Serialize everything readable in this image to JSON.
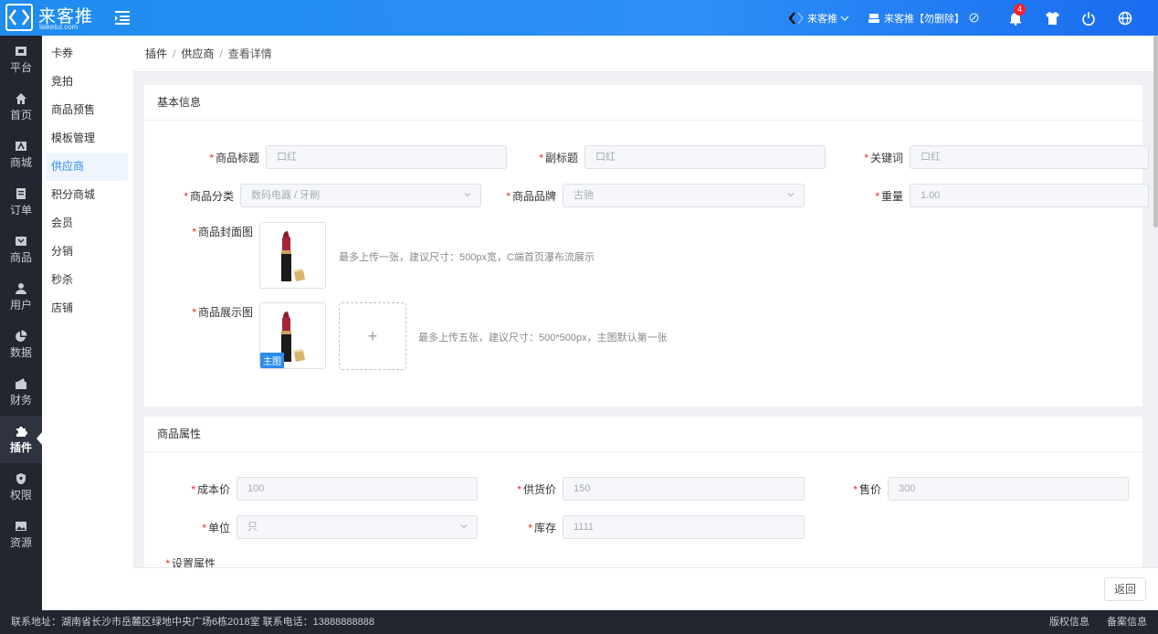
{
  "app": {
    "logo_name": "来客推",
    "logo_sub": "laiketui.com"
  },
  "topbar": {
    "store_label": "来客推",
    "user_label": "来客推【勿删除】",
    "notification_count": "4"
  },
  "leftnav": [
    {
      "label": "平台",
      "icon": "platform-icon"
    },
    {
      "label": "首页",
      "icon": "home-icon"
    },
    {
      "label": "商城",
      "icon": "mall-icon"
    },
    {
      "label": "订单",
      "icon": "order-icon"
    },
    {
      "label": "商品",
      "icon": "product-icon"
    },
    {
      "label": "用户",
      "icon": "user-icon"
    },
    {
      "label": "数据",
      "icon": "pie-chart-icon"
    },
    {
      "label": "财务",
      "icon": "wallet-icon"
    },
    {
      "label": "插件",
      "icon": "puzzle-icon",
      "active": true
    },
    {
      "label": "权限",
      "icon": "shield-icon"
    },
    {
      "label": "资源",
      "icon": "image-icon"
    }
  ],
  "subnav": [
    {
      "label": "卡券"
    },
    {
      "label": "竞拍"
    },
    {
      "label": "商品预售"
    },
    {
      "label": "模板管理"
    },
    {
      "label": "供应商",
      "active": true
    },
    {
      "label": "积分商城"
    },
    {
      "label": "会员"
    },
    {
      "label": "分销"
    },
    {
      "label": "秒杀"
    },
    {
      "label": "店铺"
    }
  ],
  "breadcrumb": [
    "插件",
    "供应商",
    "查看详情"
  ],
  "basic": {
    "title": "基本信息",
    "product_title_label": "商品标题",
    "product_title_value": "口红",
    "subtitle_label": "副标题",
    "subtitle_value": "口红",
    "keywords_label": "关键词",
    "keywords_value": "口红",
    "category_label": "商品分类",
    "category_value": "数码电器 / 牙刷",
    "brand_label": "商品品牌",
    "brand_value": "古驰",
    "weight_label": "重量",
    "weight_value": "1.00",
    "cover_label": "商品封面图",
    "cover_hint": "最多上传一张，建议尺寸：500px宽，C端首页瀑布流展示",
    "display_label": "商品展示图",
    "display_hint": "最多上传五张，建议尺寸：500*500px，主图默认第一张",
    "main_tag": "主图",
    "upload_plus": "+"
  },
  "attrs": {
    "title": "商品属性",
    "cost_label": "成本价",
    "cost_value": "100",
    "supply_label": "供货价",
    "supply_value": "150",
    "price_label": "售价",
    "price_value": "300",
    "unit_label": "单位",
    "unit_value": "只",
    "stock_label": "库存",
    "stock_value": "1111",
    "set_attr_label": "设置属性"
  },
  "actions": {
    "back_label": "返回"
  },
  "footer": {
    "address": "联系地址：湖南省长沙市岳麓区绿地中央广场6栋2018室 联系电话：13888888888",
    "copyright": "版权信息",
    "record": "备案信息"
  },
  "colors": {
    "brand": "#2c8ff6",
    "nav_bg": "#23262f",
    "required": "#f5222d"
  }
}
